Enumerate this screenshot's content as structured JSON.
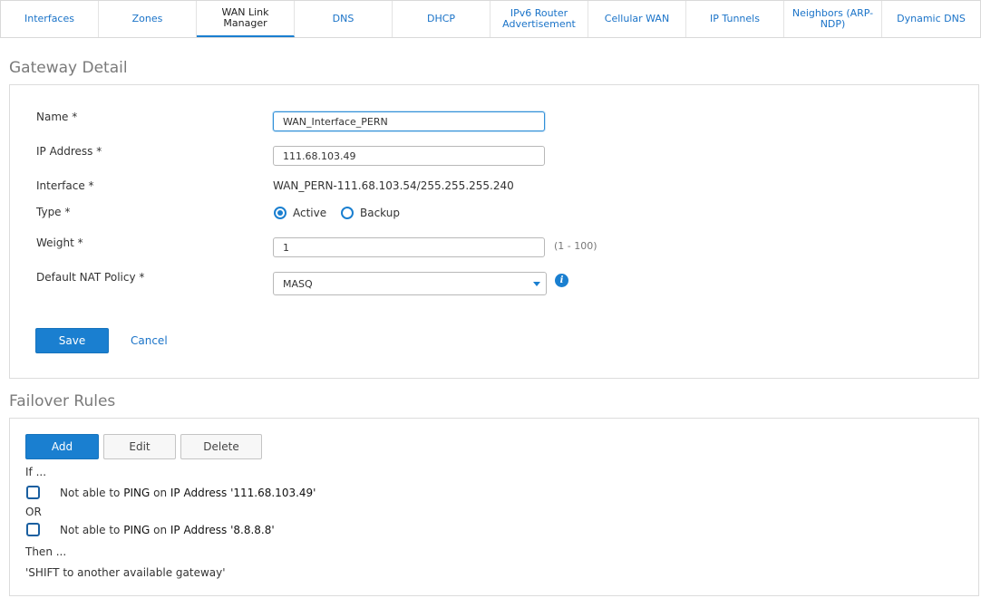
{
  "tabs": [
    {
      "label": "Interfaces"
    },
    {
      "label": "Zones"
    },
    {
      "label": "WAN Link Manager"
    },
    {
      "label": "DNS"
    },
    {
      "label": "DHCP"
    },
    {
      "label": "IPv6 Router Advertisement"
    },
    {
      "label": "Cellular WAN"
    },
    {
      "label": "IP Tunnels"
    },
    {
      "label": "Neighbors (ARP-NDP)"
    },
    {
      "label": "Dynamic DNS"
    }
  ],
  "gateway_detail": {
    "title": "Gateway Detail",
    "name_label": "Name *",
    "name_value": "WAN_Interface_PERN",
    "ip_label": "IP Address *",
    "ip_value": "111.68.103.49",
    "interface_label": "Interface *",
    "interface_value": "WAN_PERN-111.68.103.54/255.255.255.240",
    "type_label": "Type *",
    "type_options": [
      "Active",
      "Backup"
    ],
    "type_selected": "Active",
    "weight_label": "Weight *",
    "weight_value": "1",
    "weight_hint": "(1 - 100)",
    "nat_label": "Default NAT Policy *",
    "nat_value": "MASQ",
    "info_icon": "info-icon",
    "save_label": "Save",
    "cancel_label": "Cancel"
  },
  "failover": {
    "title": "Failover Rules",
    "add_label": "Add",
    "edit_label": "Edit",
    "delete_label": "Delete",
    "if_label": "If ...",
    "or_label": "OR",
    "then_label": "Then ...",
    "rules": [
      {
        "prefix": "Not able to",
        "method": "PING",
        "on": "on",
        "target": "IP Address '111.68.103.49'"
      },
      {
        "prefix": "Not able to",
        "method": "PING",
        "on": "on",
        "target": "IP Address '8.8.8.8'"
      }
    ],
    "action": "'SHIFT to another available gateway'"
  },
  "colors": {
    "accent": "#1a7fd0",
    "link": "#1a73c8",
    "title_gray": "#7a7a7a"
  }
}
